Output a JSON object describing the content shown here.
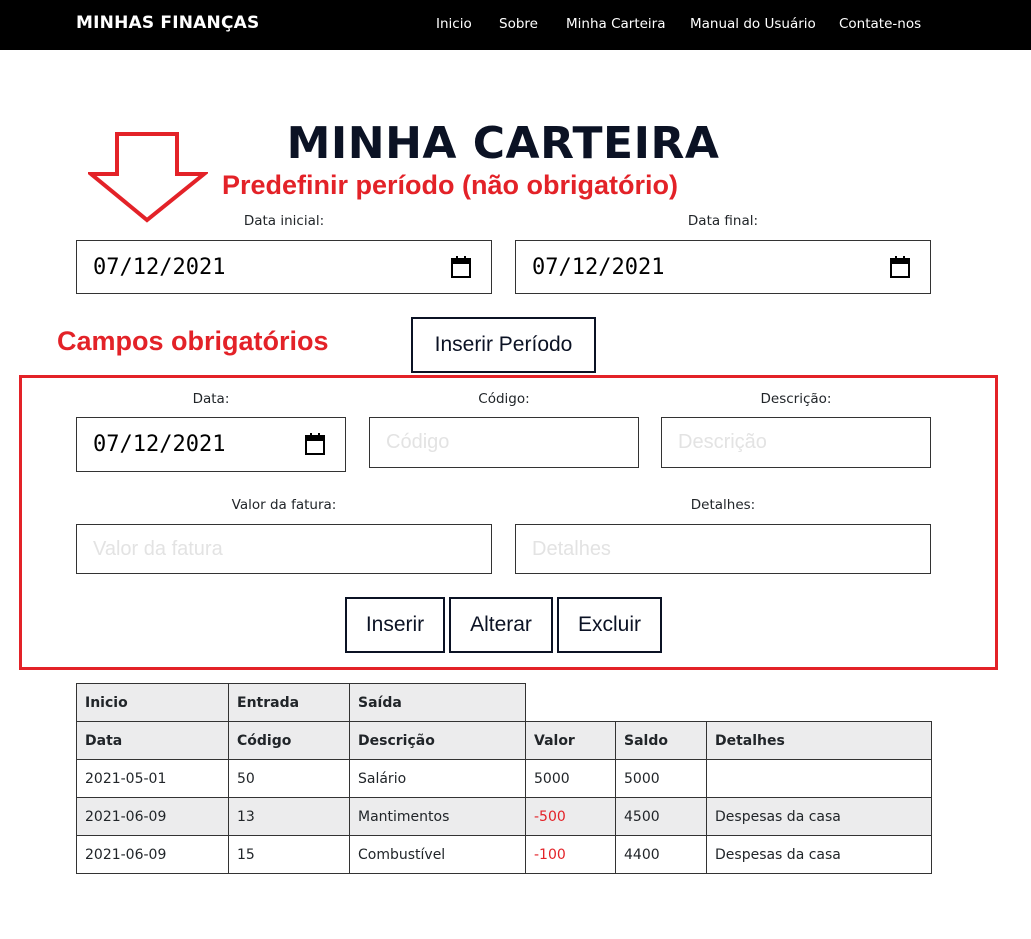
{
  "navbar": {
    "brand": "MINHAS FINANÇAS",
    "links": [
      "Inicio",
      "Sobre",
      "Minha Carteira",
      "Manual do Usuário",
      "Contate-nos"
    ]
  },
  "page": {
    "title": "MINHA CARTEIRA"
  },
  "annotations": {
    "period_note": "Predefinir período (não obrigatório)",
    "required_note": "Campos obrigatórios",
    "color": "#e32228"
  },
  "period": {
    "start_label": "Data inicial:",
    "start_value": "07/12/2021",
    "end_label": "Data final:",
    "end_value": "07/12/2021",
    "insert_button": "Inserir Período"
  },
  "form": {
    "date_label": "Data:",
    "date_value": "07/12/2021",
    "code_label": "Código:",
    "code_placeholder": "Código",
    "desc_label": "Descrição:",
    "desc_placeholder": "Descrição",
    "amount_label": "Valor da fatura:",
    "amount_placeholder": "Valor da fatura",
    "details_label": "Detalhes:",
    "details_placeholder": "Detalhes",
    "buttons": {
      "insert": "Inserir",
      "edit": "Alterar",
      "delete": "Excluir"
    }
  },
  "table": {
    "top_headers": [
      "Inicio",
      "Entrada",
      "Saída"
    ],
    "headers": [
      "Data",
      "Código",
      "Descrição",
      "Valor",
      "Saldo",
      "Detalhes"
    ],
    "rows": [
      [
        "2021-05-01",
        "50",
        "Salário",
        "5000",
        "5000",
        ""
      ],
      [
        "2021-06-09",
        "13",
        "Mantimentos",
        "-500",
        "4500",
        "Despesas da casa"
      ],
      [
        "2021-06-09",
        "15",
        "Combustível",
        "-100",
        "4400",
        "Despesas da casa"
      ]
    ]
  },
  "colors": {
    "navbar_bg": "#000000",
    "title": "#0b1224",
    "negative": "#e32228",
    "table_header_bg": "#ececed"
  }
}
